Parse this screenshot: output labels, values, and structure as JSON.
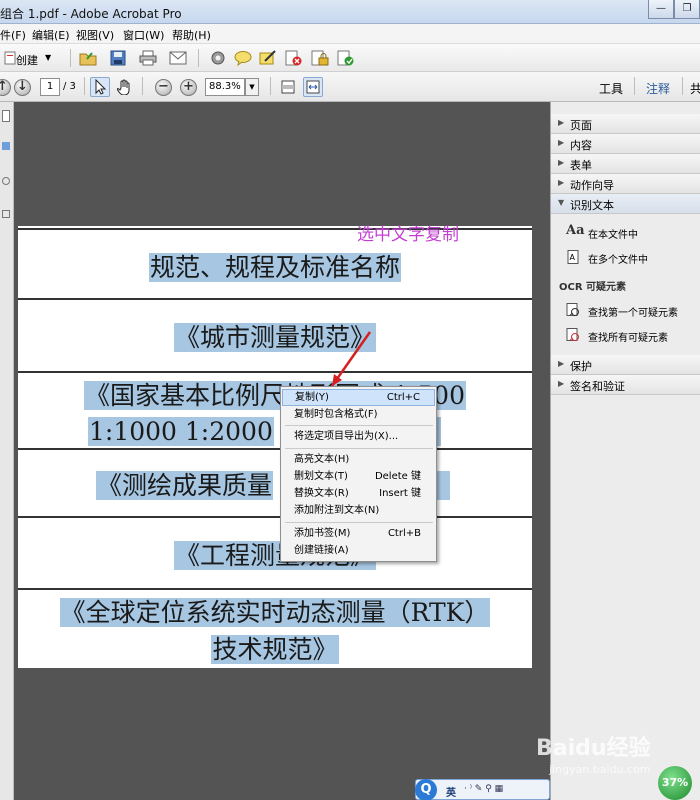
{
  "window": {
    "title": "组合 1.pdf - Adobe Acrobat Pro",
    "minimize": "—",
    "restore": "❐",
    "close": "✕"
  },
  "menu": [
    "件(F)",
    "编辑(E)",
    "视图(V)",
    "窗口(W)",
    "帮助(H)"
  ],
  "toolbar": {
    "create_label": "创建",
    "page_current": "1",
    "page_total": "/ 3",
    "zoom": "88.3%",
    "tools_link": "工具",
    "comment_link": "注释",
    "share_link": "共"
  },
  "document": {
    "annotation": "选中文字复制",
    "rows": [
      [
        "规范、规程及标准名称"
      ],
      [
        "《城市测量规范》"
      ],
      [
        "《国家基本比例尺地形图式 1:500",
        "1:1000  1:2000"
      ],
      [
        "《测绘成果质量"
      ],
      [
        "《工程测量规范》"
      ],
      [
        "《全球定位系统实时动态测量（RTK）",
        "技术规范》"
      ]
    ]
  },
  "context_menu": {
    "items": [
      {
        "label": "复制(Y)",
        "shortcut": "Ctrl+C"
      },
      {
        "label": "复制时包含格式(F)",
        "shortcut": ""
      },
      {
        "label": "将选定项目导出为(X)...",
        "shortcut": ""
      },
      {
        "label": "高亮文本(H)",
        "shortcut": ""
      },
      {
        "label": "删划文本(T)",
        "shortcut": "Delete 键"
      },
      {
        "label": "替换文本(R)",
        "shortcut": "Insert 键"
      },
      {
        "label": "添加附注到文本(N)",
        "shortcut": ""
      },
      {
        "label": "添加书签(M)",
        "shortcut": "Ctrl+B"
      },
      {
        "label": "创建链接(A)",
        "shortcut": ""
      }
    ]
  },
  "right_panel": {
    "sections": [
      "页面",
      "内容",
      "表单",
      "动作向导",
      "识别文本"
    ],
    "recognize_items": [
      "在本文件中",
      "在多个文件中"
    ],
    "ocr_label": "OCR 可疑元素",
    "ocr_items": [
      "查找第一个可疑元素",
      "查找所有可疑元素"
    ],
    "bottom_sections": [
      "保护",
      "签名和验证"
    ]
  },
  "tray": {
    "ime_lang": "英",
    "battery": "37%"
  },
  "watermark": {
    "brand": "Baidu经验",
    "url": "jingyan.baidu.com"
  },
  "colors": {
    "highlight": "#a6c6e2",
    "annotation": "#c33fd2",
    "doc_bg": "#545454"
  }
}
